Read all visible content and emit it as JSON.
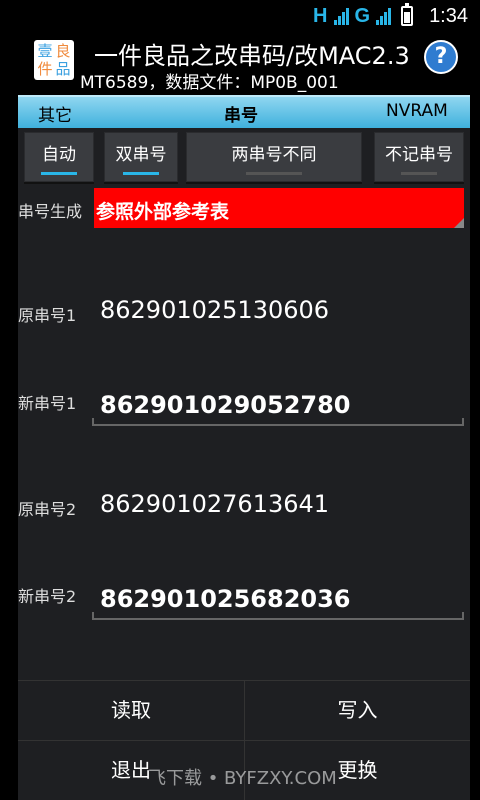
{
  "status_bar": {
    "network_1": "H",
    "network_2": "G",
    "time": "1:34",
    "accent": "#29b6e8"
  },
  "header": {
    "logo_chars": [
      "壹",
      "良",
      "件",
      "品"
    ],
    "title": "一件良品之改串码/改MAC2.3",
    "subtitle": "MT6589，数据文件：MP0B_001",
    "help_label": "?"
  },
  "tabs": [
    {
      "label": "其它",
      "active": false
    },
    {
      "label": "串号",
      "active": true
    },
    {
      "label": "NVRAM",
      "active": false
    }
  ],
  "mode_buttons": [
    {
      "label": "自动",
      "on": true
    },
    {
      "label": "双串号",
      "on": true
    },
    {
      "label": "两串号不同",
      "on": false
    },
    {
      "label": "不记串号",
      "on": false
    }
  ],
  "serial_gen": {
    "label": "串号生成",
    "value": "参照外部参考表",
    "color": "#ff0000"
  },
  "fields": {
    "orig1_label": "原串号1",
    "orig1_value": "862901025130606",
    "new1_label": "新串号1",
    "new1_value": "862901029052780",
    "orig2_label": "原串号2",
    "orig2_value": "862901027613641",
    "new2_label": "新串号2",
    "new2_value": "862901025682036"
  },
  "actions": {
    "read": "读取",
    "write": "写入",
    "exit": "退出",
    "replace": "更换"
  },
  "watermark": "飞下载 • BYFZXY.COM"
}
